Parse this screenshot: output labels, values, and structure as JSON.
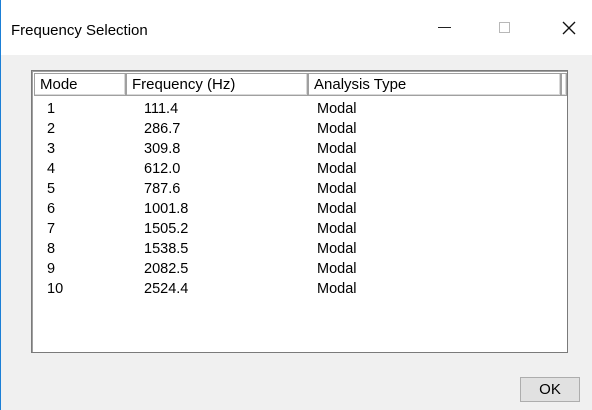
{
  "window": {
    "title": "Frequency Selection",
    "accent_color": "#1b7fd6",
    "controls": {
      "minimize_icon": "minimize-icon",
      "maximize_icon": "maximize-icon",
      "close_icon": "close-icon",
      "close_glyph": "✕"
    }
  },
  "table": {
    "columns": [
      "Mode",
      "Frequency (Hz)",
      "Analysis Type"
    ],
    "rows": [
      {
        "mode": "1",
        "frequency": "111.4",
        "type": "Modal"
      },
      {
        "mode": "2",
        "frequency": "286.7",
        "type": "Modal"
      },
      {
        "mode": "3",
        "frequency": "309.8",
        "type": "Modal"
      },
      {
        "mode": "4",
        "frequency": "612.0",
        "type": "Modal"
      },
      {
        "mode": "5",
        "frequency": "787.6",
        "type": "Modal"
      },
      {
        "mode": "6",
        "frequency": "1001.8",
        "type": "Modal"
      },
      {
        "mode": "7",
        "frequency": "1505.2",
        "type": "Modal"
      },
      {
        "mode": "8",
        "frequency": "1538.5",
        "type": "Modal"
      },
      {
        "mode": "9",
        "frequency": "2082.5",
        "type": "Modal"
      },
      {
        "mode": "10",
        "frequency": "2524.4",
        "type": "Modal"
      }
    ]
  },
  "buttons": {
    "ok_label": "OK"
  }
}
